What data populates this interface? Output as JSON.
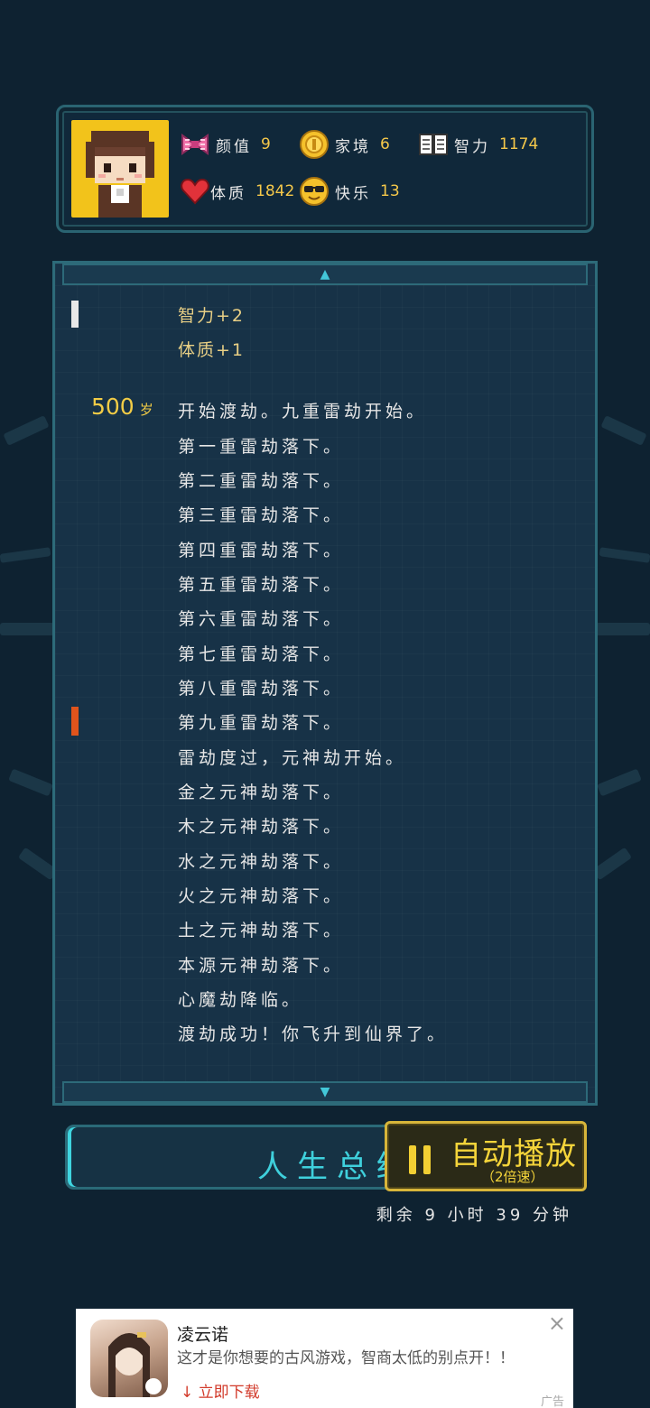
{
  "stats": {
    "appearance": {
      "label": "颜值",
      "value": "9",
      "icon": "bow-icon"
    },
    "family": {
      "label": "家境",
      "value": "6",
      "icon": "coin-icon"
    },
    "intelligence": {
      "label": "智力",
      "value": "1174",
      "icon": "book-icon"
    },
    "constitution": {
      "label": "体质",
      "value": "1842",
      "icon": "heart-icon"
    },
    "happiness": {
      "label": "快乐",
      "value": "13",
      "icon": "sunglasses-face-icon"
    }
  },
  "log": {
    "scroll_up": "▲",
    "scroll_down": "▼",
    "gains": [
      "智力+2",
      "体质+1"
    ],
    "age": "500",
    "age_unit": "岁",
    "events": [
      "开始渡劫。九重雷劫开始。",
      "第一重雷劫落下。",
      "第二重雷劫落下。",
      "第三重雷劫落下。",
      "第四重雷劫落下。",
      "第五重雷劫落下。",
      "第六重雷劫落下。",
      "第七重雷劫落下。",
      "第八重雷劫落下。",
      "第九重雷劫落下。",
      "雷劫度过，元神劫开始。",
      "金之元神劫落下。",
      "木之元神劫落下。",
      "水之元神劫落下。",
      "火之元神劫落下。",
      "土之元神劫落下。",
      "本源元神劫落下。",
      "心魔劫降临。",
      "渡劫成功！你飞升到仙界了。"
    ]
  },
  "buttons": {
    "summary": "人生总结",
    "auto_play": "自动播放",
    "auto_speed": "（2倍速）"
  },
  "time_left": "剩余 9 小时 39 分钟",
  "ad": {
    "title": "凌云诺",
    "description": "这才是你想要的古风游戏，智商太低的别点开！！",
    "download": "↓ 立即下载",
    "close": "×",
    "tag": "广告"
  },
  "colors": {
    "background": "#0e2231",
    "panel_border": "#2d6a79",
    "gold": "#f2cc46",
    "cyan": "#3fd0dc"
  }
}
